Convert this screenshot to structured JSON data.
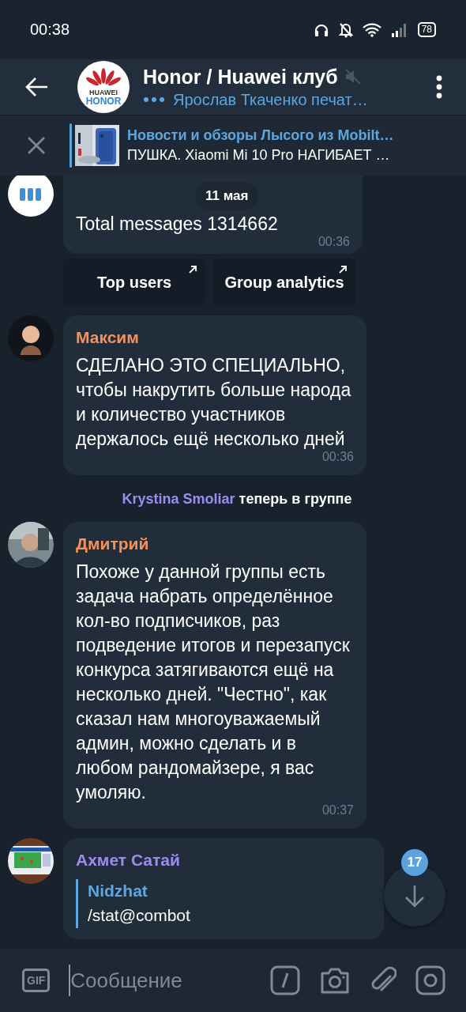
{
  "status_bar": {
    "time": "00:38",
    "battery": "78"
  },
  "header": {
    "title": "Honor / Huawei клуб",
    "muted": true,
    "typing": "Ярослав Ткаченко печат…",
    "avatar_lines": [
      "HUAWEI",
      "HONOR"
    ]
  },
  "pinned": {
    "title": "Новости и обзоры Лысого из Mobilt…",
    "text": "ПУШКА. Xiaomi Mi 10 Pro НАГИБАЕТ …"
  },
  "date_pill": "11 мая",
  "messages": [
    {
      "kind": "bot",
      "text": "Total messages 1314662",
      "time": "00:36",
      "buttons": [
        "Top users",
        "Group analytics"
      ]
    },
    {
      "kind": "message",
      "sender": "Максим",
      "color": "#f0925c",
      "text": "СДЕЛАНО ЭТО СПЕЦИАЛЬНО, чтобы накрутить больше народа и количество участников держалось ещё несколько дней",
      "time": "00:36"
    },
    {
      "kind": "service",
      "name": "Krystina Smoliar",
      "text": "теперь в группе"
    },
    {
      "kind": "message",
      "sender": "Дмитрий",
      "color": "#f0925c",
      "text": "Похоже у данной группы есть задача набрать определённое кол-во подписчиков, раз подведение итогов и перезапуск конкурса затягиваются ещё на несколько дней. \"Честно\", как сказал нам многоуважаемый админ, можно сделать и в любом рандомайзере, я вас умоляю.",
      "time": "00:37"
    },
    {
      "kind": "reply",
      "sender": "Ахмет Сатай",
      "color": "#9d8cf0",
      "reply_name": "Nidzhat",
      "reply_text": "/stat@combot"
    }
  ],
  "scroll_badge": "17",
  "input": {
    "gif": "GIF",
    "placeholder": "Сообщение"
  }
}
